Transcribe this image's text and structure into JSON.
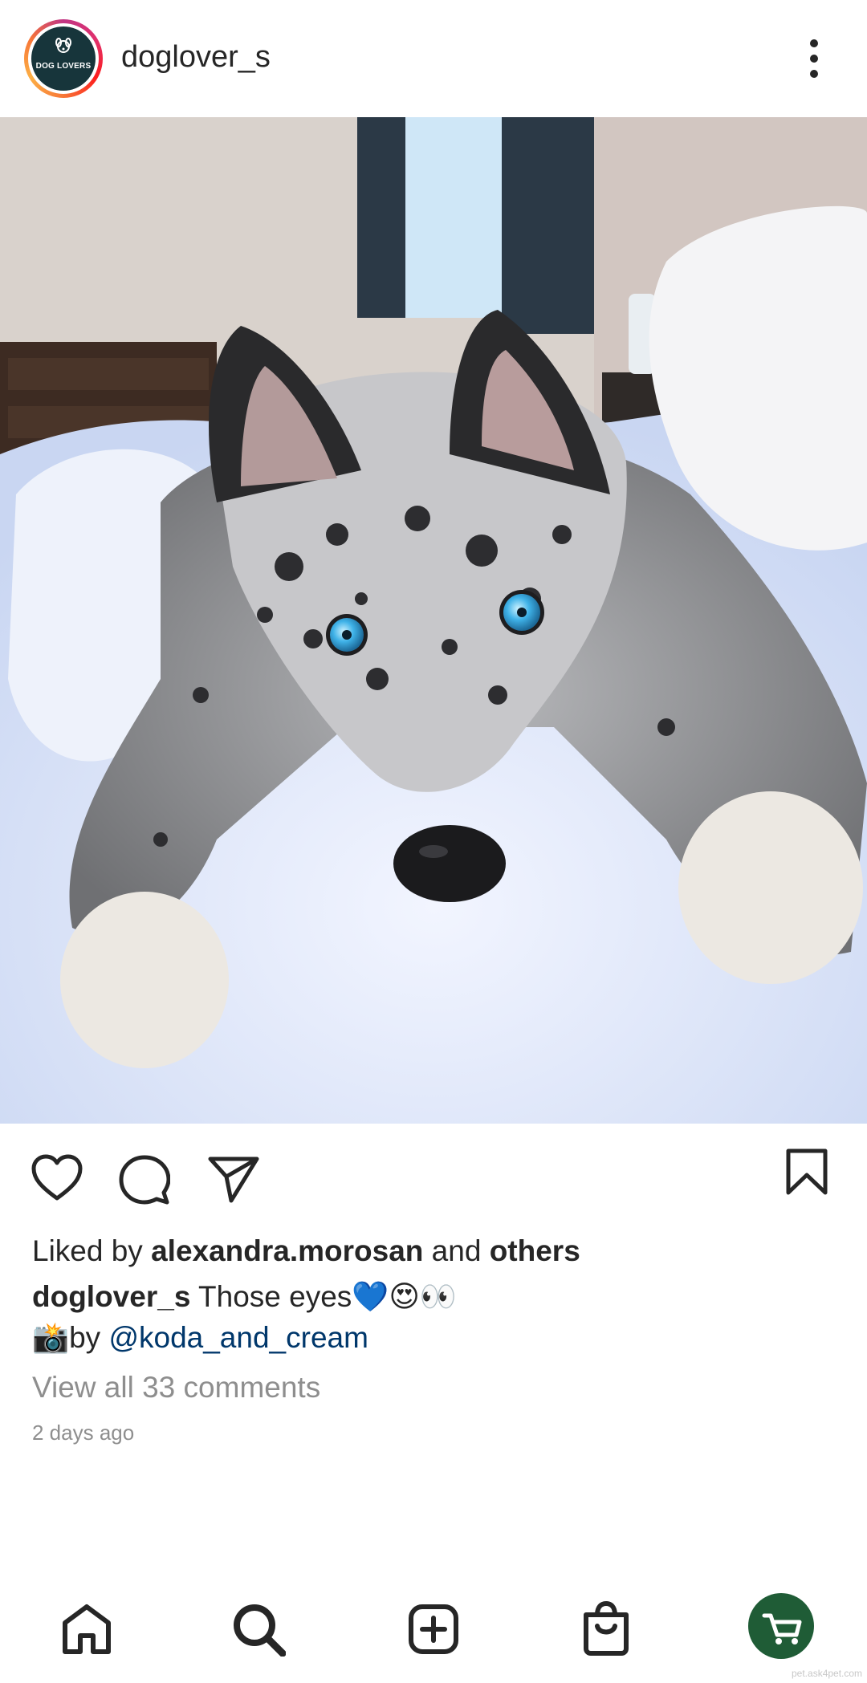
{
  "post": {
    "username": "doglover_s",
    "avatar_text": "DOG LOVERS",
    "liked_by_prefix": "Liked by ",
    "liked_by_user": "alexandra.morosan",
    "liked_by_middle": " and ",
    "liked_by_others": "others",
    "caption_user": "doglover_s",
    "caption_text": " Those eyes💙😍👀",
    "credit_prefix": "📸by ",
    "credit_mention": "@koda_and_cream",
    "view_comments": "View all 33 comments",
    "timestamp": "2 days ago"
  },
  "icons": {
    "more": "more-vertical-icon",
    "like": "heart-icon",
    "comment": "comment-icon",
    "share": "send-icon",
    "save": "bookmark-icon",
    "home": "home-icon",
    "search": "search-icon",
    "add": "add-post-icon",
    "shop": "shop-bag-icon",
    "profile": "profile-avatar"
  },
  "watermark": "pet.ask4pet.com"
}
